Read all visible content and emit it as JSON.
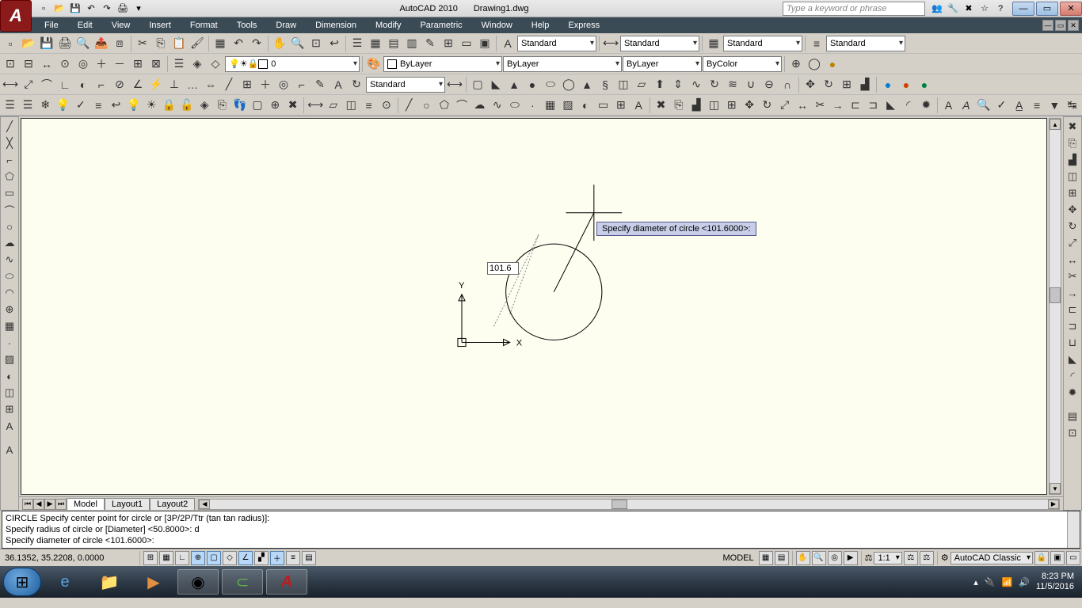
{
  "title": {
    "app": "AutoCAD 2010",
    "doc": "Drawing1.dwg"
  },
  "search_placeholder": "Type a keyword or phrase",
  "menus": [
    "File",
    "Edit",
    "View",
    "Insert",
    "Format",
    "Tools",
    "Draw",
    "Dimension",
    "Modify",
    "Parametric",
    "Window",
    "Help",
    "Express"
  ],
  "styles": {
    "text": "Standard",
    "dim": "Standard",
    "table": "Standard",
    "ml": "Standard"
  },
  "layers": {
    "current": "0",
    "layer_dd": "ByLayer",
    "line_dd": "ByLayer",
    "lw_dd": "ByLayer",
    "color_dd": "ByColor"
  },
  "dimstyle_dd": "Standard",
  "dynamic_prompt": "Specify diameter of circle <101.6000>:",
  "dynamic_input": "101.6",
  "ucs": {
    "x_label": "X",
    "y_label": "Y"
  },
  "tabs": {
    "model": "Model",
    "layout1": "Layout1",
    "layout2": "Layout2"
  },
  "command": {
    "l1": "CIRCLE Specify center point for circle or [3P/2P/Ttr (tan tan radius)]:",
    "l2": "Specify radius of circle or [Diameter] <50.8000>: d",
    "l3": "",
    "l4": "Specify diameter of circle <101.6000>:"
  },
  "status": {
    "coords": "36.1352,   35.2208, 0.0000",
    "model": "MODEL",
    "scale": "1:1",
    "workspace": "AutoCAD Classic"
  },
  "tray": {
    "time": "8:23 PM",
    "date": "11/5/2016"
  },
  "annotation_lbl": "A"
}
